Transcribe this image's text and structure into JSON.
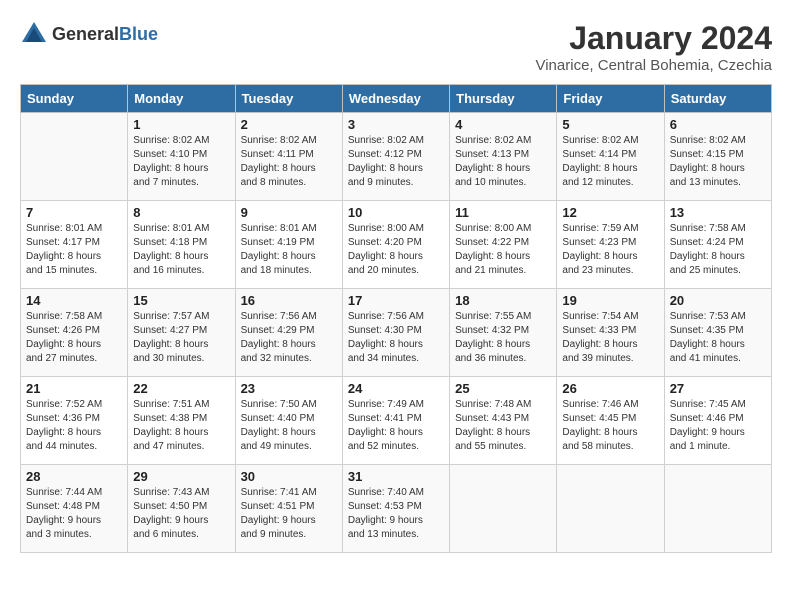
{
  "header": {
    "logo_general": "General",
    "logo_blue": "Blue",
    "month_title": "January 2024",
    "location": "Vinarice, Central Bohemia, Czechia"
  },
  "days_of_week": [
    "Sunday",
    "Monday",
    "Tuesday",
    "Wednesday",
    "Thursday",
    "Friday",
    "Saturday"
  ],
  "weeks": [
    [
      {
        "day": "",
        "content": ""
      },
      {
        "day": "1",
        "content": "Sunrise: 8:02 AM\nSunset: 4:10 PM\nDaylight: 8 hours\nand 7 minutes."
      },
      {
        "day": "2",
        "content": "Sunrise: 8:02 AM\nSunset: 4:11 PM\nDaylight: 8 hours\nand 8 minutes."
      },
      {
        "day": "3",
        "content": "Sunrise: 8:02 AM\nSunset: 4:12 PM\nDaylight: 8 hours\nand 9 minutes."
      },
      {
        "day": "4",
        "content": "Sunrise: 8:02 AM\nSunset: 4:13 PM\nDaylight: 8 hours\nand 10 minutes."
      },
      {
        "day": "5",
        "content": "Sunrise: 8:02 AM\nSunset: 4:14 PM\nDaylight: 8 hours\nand 12 minutes."
      },
      {
        "day": "6",
        "content": "Sunrise: 8:02 AM\nSunset: 4:15 PM\nDaylight: 8 hours\nand 13 minutes."
      }
    ],
    [
      {
        "day": "7",
        "content": "Sunrise: 8:01 AM\nSunset: 4:17 PM\nDaylight: 8 hours\nand 15 minutes."
      },
      {
        "day": "8",
        "content": "Sunrise: 8:01 AM\nSunset: 4:18 PM\nDaylight: 8 hours\nand 16 minutes."
      },
      {
        "day": "9",
        "content": "Sunrise: 8:01 AM\nSunset: 4:19 PM\nDaylight: 8 hours\nand 18 minutes."
      },
      {
        "day": "10",
        "content": "Sunrise: 8:00 AM\nSunset: 4:20 PM\nDaylight: 8 hours\nand 20 minutes."
      },
      {
        "day": "11",
        "content": "Sunrise: 8:00 AM\nSunset: 4:22 PM\nDaylight: 8 hours\nand 21 minutes."
      },
      {
        "day": "12",
        "content": "Sunrise: 7:59 AM\nSunset: 4:23 PM\nDaylight: 8 hours\nand 23 minutes."
      },
      {
        "day": "13",
        "content": "Sunrise: 7:58 AM\nSunset: 4:24 PM\nDaylight: 8 hours\nand 25 minutes."
      }
    ],
    [
      {
        "day": "14",
        "content": "Sunrise: 7:58 AM\nSunset: 4:26 PM\nDaylight: 8 hours\nand 27 minutes."
      },
      {
        "day": "15",
        "content": "Sunrise: 7:57 AM\nSunset: 4:27 PM\nDaylight: 8 hours\nand 30 minutes."
      },
      {
        "day": "16",
        "content": "Sunrise: 7:56 AM\nSunset: 4:29 PM\nDaylight: 8 hours\nand 32 minutes."
      },
      {
        "day": "17",
        "content": "Sunrise: 7:56 AM\nSunset: 4:30 PM\nDaylight: 8 hours\nand 34 minutes."
      },
      {
        "day": "18",
        "content": "Sunrise: 7:55 AM\nSunset: 4:32 PM\nDaylight: 8 hours\nand 36 minutes."
      },
      {
        "day": "19",
        "content": "Sunrise: 7:54 AM\nSunset: 4:33 PM\nDaylight: 8 hours\nand 39 minutes."
      },
      {
        "day": "20",
        "content": "Sunrise: 7:53 AM\nSunset: 4:35 PM\nDaylight: 8 hours\nand 41 minutes."
      }
    ],
    [
      {
        "day": "21",
        "content": "Sunrise: 7:52 AM\nSunset: 4:36 PM\nDaylight: 8 hours\nand 44 minutes."
      },
      {
        "day": "22",
        "content": "Sunrise: 7:51 AM\nSunset: 4:38 PM\nDaylight: 8 hours\nand 47 minutes."
      },
      {
        "day": "23",
        "content": "Sunrise: 7:50 AM\nSunset: 4:40 PM\nDaylight: 8 hours\nand 49 minutes."
      },
      {
        "day": "24",
        "content": "Sunrise: 7:49 AM\nSunset: 4:41 PM\nDaylight: 8 hours\nand 52 minutes."
      },
      {
        "day": "25",
        "content": "Sunrise: 7:48 AM\nSunset: 4:43 PM\nDaylight: 8 hours\nand 55 minutes."
      },
      {
        "day": "26",
        "content": "Sunrise: 7:46 AM\nSunset: 4:45 PM\nDaylight: 8 hours\nand 58 minutes."
      },
      {
        "day": "27",
        "content": "Sunrise: 7:45 AM\nSunset: 4:46 PM\nDaylight: 9 hours\nand 1 minute."
      }
    ],
    [
      {
        "day": "28",
        "content": "Sunrise: 7:44 AM\nSunset: 4:48 PM\nDaylight: 9 hours\nand 3 minutes."
      },
      {
        "day": "29",
        "content": "Sunrise: 7:43 AM\nSunset: 4:50 PM\nDaylight: 9 hours\nand 6 minutes."
      },
      {
        "day": "30",
        "content": "Sunrise: 7:41 AM\nSunset: 4:51 PM\nDaylight: 9 hours\nand 9 minutes."
      },
      {
        "day": "31",
        "content": "Sunrise: 7:40 AM\nSunset: 4:53 PM\nDaylight: 9 hours\nand 13 minutes."
      },
      {
        "day": "",
        "content": ""
      },
      {
        "day": "",
        "content": ""
      },
      {
        "day": "",
        "content": ""
      }
    ]
  ]
}
